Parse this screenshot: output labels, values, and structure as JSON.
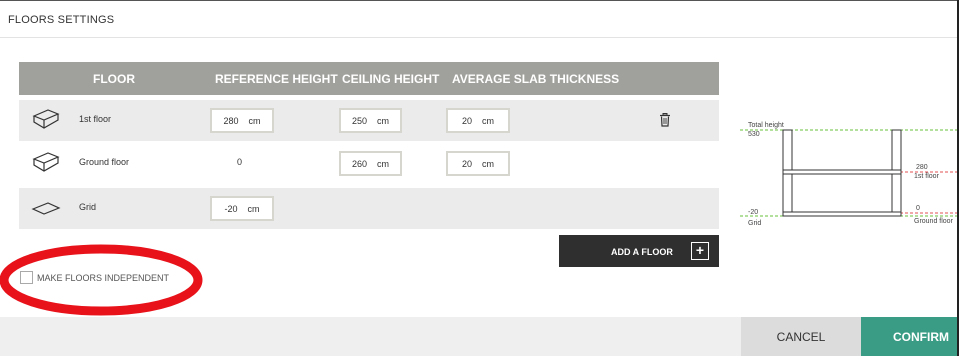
{
  "header": {
    "title": "FLOORS SETTINGS"
  },
  "table": {
    "columns": [
      "FLOOR",
      "REFERENCE HEIGHT",
      "CEILING HEIGHT",
      "AVERAGE SLAB THICKNESS"
    ],
    "rows": [
      {
        "name": "1st floor",
        "icon": "floor-box-icon",
        "reference_height": "280",
        "reference_unit": "cm",
        "ceiling_height": "250",
        "ceiling_unit": "cm",
        "slab_thickness": "20",
        "slab_unit": "cm",
        "deletable": true
      },
      {
        "name": "Ground floor",
        "icon": "floor-box-icon",
        "reference_height": "0",
        "ceiling_height": "260",
        "ceiling_unit": "cm",
        "slab_thickness": "20",
        "slab_unit": "cm",
        "deletable": false
      },
      {
        "name": "Grid",
        "icon": "grid-plane-icon",
        "reference_height": "-20",
        "reference_unit": "cm",
        "deletable": false
      }
    ]
  },
  "add_floor": {
    "label": "ADD A FLOOR",
    "icon": "plus-icon"
  },
  "independent": {
    "label": "MAKE FLOORS INDEPENDENT",
    "checked": false
  },
  "diagram": {
    "left_labels": {
      "total_label": "Total height",
      "total_value": "530",
      "grid_value": "-20",
      "grid_label": "Grid"
    },
    "right_labels": {
      "first_value": "280",
      "first_label": "1st floor",
      "ground_value": "0",
      "ground_label": "Ground floor"
    }
  },
  "footer": {
    "cancel_label": "CANCEL",
    "confirm_label": "CONFIRM"
  },
  "colors": {
    "table_header": "#a0a19c",
    "row_shaded": "#ebebeb",
    "confirm": "#3a9c84",
    "add_button": "#2f2f2f",
    "annotation": "#e8121a",
    "level_green": "#67c23a",
    "level_red": "#e05252"
  }
}
